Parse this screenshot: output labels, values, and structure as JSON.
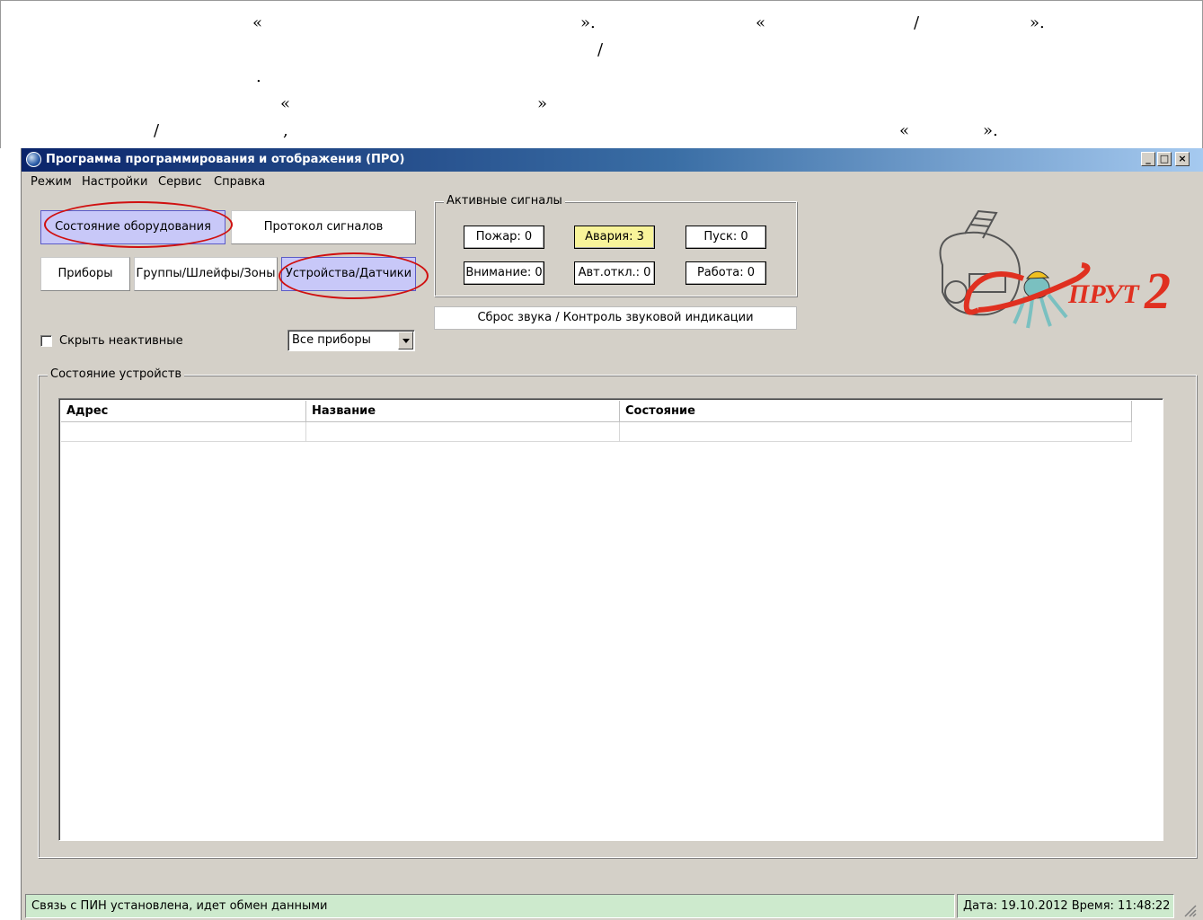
{
  "doc_fragment": {
    "line1": [
      "«",
      "».",
      "«",
      "/",
      "»."
    ],
    "line2": [
      "/"
    ],
    "line3": [
      "."
    ],
    "line4": [
      "«",
      "»"
    ],
    "line5": [
      "/",
      ",",
      "«",
      "»."
    ]
  },
  "window": {
    "title": "Программа программирования и отображения (ПРО)",
    "controls": {
      "minimize": "_",
      "maximize": "□",
      "close": "×"
    }
  },
  "menu": [
    "Режим",
    "Настройки",
    "Сервис",
    "Справка"
  ],
  "nav": {
    "equipment_state": "Состояние оборудования",
    "signal_log": "Протокол сигналов",
    "devices": "Приборы",
    "groups": "Группы/Шлейфы/Зоны",
    "sensors": "Устройства/Датчики"
  },
  "active_signals": {
    "legend": "Активные сигналы",
    "fire": "Пожар: 0",
    "failure": "Авария: 3",
    "start": "Пуск: 0",
    "attention": "Внимание: 0",
    "auto_off": "Авт.откл.: 0",
    "work": "Работа: 0"
  },
  "reset_sound_label": "Сброс звука / Контроль  звуковой индикации",
  "hide_inactive_label": "Скрыть неактивные",
  "device_filter": {
    "selected": "Все приборы"
  },
  "device_state": {
    "legend": "Состояние устройств",
    "columns": [
      "Адрес",
      "Название",
      "Состояние"
    ],
    "rows": []
  },
  "logo": {
    "text": "ПРУТ",
    "number": "2"
  },
  "status": {
    "connection": "Связь с ПИН установлена, идет обмен данными",
    "datetime": "Дата: 19.10.2012  Время: 11:48:22"
  },
  "colors": {
    "accent_ring": "#d01010",
    "selected_tab": "#c8c8f8",
    "warning": "#f8f49a",
    "status_panel": "#cdeacd"
  }
}
